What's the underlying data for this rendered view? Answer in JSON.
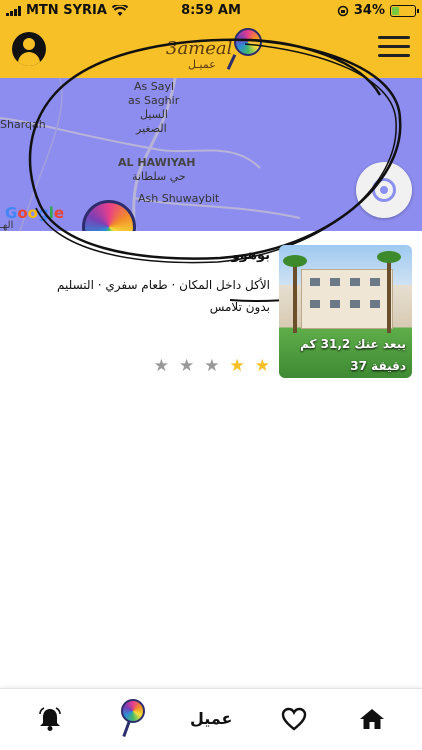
{
  "status_bar": {
    "carrier": "MTN SYRIA",
    "time": "8:59 AM",
    "battery": "34%",
    "battery_level": 0.34
  },
  "header": {
    "logo_latin": "3ameal",
    "logo_arabic": "عميـل",
    "profile_icon": "user-circle-icon",
    "menu_icon": "hamburger-menu-icon"
  },
  "map": {
    "labels": {
      "as_sayl": "As Sayl",
      "as_saghir": "as Saghir",
      "sayl_ar": "السيل",
      "saghir_ar": "الصغير",
      "sharqah": "Sharqah",
      "al_hawiyah": "AL HAWIYAH",
      "hawiyah_ar": "حي سلطانة",
      "ash_shuwaybit": "Ash Shuwaybit",
      "google_ar": "الهـ"
    },
    "google": {
      "g1": "G",
      "g2": "o",
      "g3": "o",
      "g4": "g",
      "g5": "l",
      "g6": "e"
    },
    "color": "#8d8df0"
  },
  "restaurant": {
    "name": "بوهوو",
    "tags": "الأكل داخل المكان · طعام سفري · التسليم بدون تلامس",
    "distance": "يبعد عنك 31,2 كم",
    "eta": "37 دقيقة",
    "rating": 2,
    "rating_max": 5
  },
  "bottom_nav": {
    "bell_icon": "bell-icon",
    "lollipop_icon": "lollipop-logo-icon",
    "label": "عميل",
    "heart_icon": "heart-icon",
    "home_icon": "home-icon"
  },
  "colors": {
    "brand_yellow": "#f6c026",
    "map_purple": "#8d8df0",
    "star_on": "#f6c026",
    "star_off": "#999999"
  }
}
